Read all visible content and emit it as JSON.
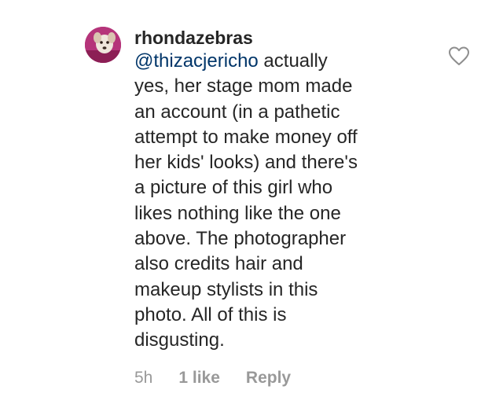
{
  "comment": {
    "username": "rhondazebras",
    "mention": "@thizacjericho",
    "lines": {
      "l1_rest": " actually",
      "l2": "yes, her stage mom made",
      "l3": "an account (in a pathetic",
      "l4": "attempt to make money off",
      "l5": "her kids' looks) and there's",
      "l6": "a picture of this girl who",
      "l7": "likes nothing like the one",
      "l8": "above. The photographer",
      "l9": "also credits hair and",
      "l10": "makeup stylists in this",
      "l11": "photo. All of this is",
      "l12": "disgusting."
    },
    "time": "5h",
    "likes": "1 like",
    "reply_label": "Reply"
  },
  "icons": {
    "like": "heart-outline-icon",
    "avatar": "profile-photo-dog"
  },
  "colors": {
    "text": "#262626",
    "mention": "#003569",
    "meta": "#999999",
    "avatar_bg": "#b5347a"
  }
}
